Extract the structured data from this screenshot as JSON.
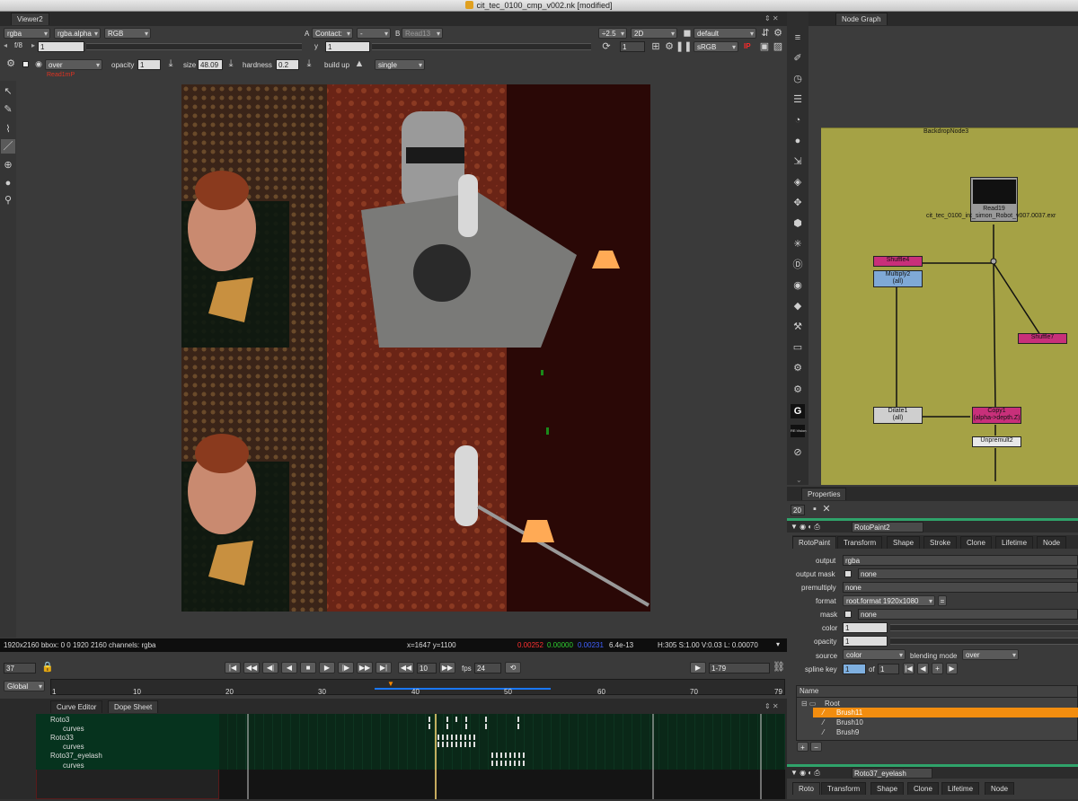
{
  "window": {
    "title": "cit_tec_0100_cmp_v002.nk [modified]"
  },
  "viewer": {
    "tab": "Viewer2",
    "channels": "rgba",
    "alpha": "rgba.alpha",
    "colorspace": "RGB",
    "a_label": "A",
    "a_input": "Contact:",
    "wipe": "-",
    "b_label": "B",
    "b_input": "Read13",
    "gain_mode": "f/8",
    "gain_value": "1",
    "gamma_label": "y",
    "gamma_value": "1",
    "zoom": "÷2.5",
    "view_mode": "2D",
    "lut": "default",
    "frame_field": "1",
    "display": "sRGB",
    "ip_label": "IP",
    "blend": "over",
    "opacity_label": "opacity",
    "opacity_value": "1",
    "size_label": "size",
    "size_value": "48.09",
    "hardness_label": "hardness",
    "hardness_value": "0.2",
    "buildup_label": "build up",
    "stroke_mode": "single",
    "red_label": "Read1mP",
    "status_left": "1920x2160 bbox: 0 0 1920 2160 channels: rgba",
    "status_xy": "x=1647 y=1100",
    "status_r": "0.00252",
    "status_g": "0.00000",
    "status_b": "0.00231",
    "status_a": "6.4e-13",
    "status_hsv": "H:305 S:1.00 V:0.03  L: 0.00070"
  },
  "timeline": {
    "frame": "37",
    "step": "10",
    "fps_label": "fps",
    "fps": "24",
    "range": "1-79",
    "global": "Global",
    "ticks": [
      "1",
      "10",
      "20",
      "30",
      "40",
      "50",
      "60",
      "70",
      "79"
    ],
    "current_marker": "37"
  },
  "dope": {
    "tab_curve": "Curve Editor",
    "tab_dope": "Dope Sheet",
    "items": [
      "Roto3",
      "curves",
      "Roto33",
      "curves",
      "Roto37_eyelash",
      "curves"
    ]
  },
  "nodegraph": {
    "tab": "Node Graph",
    "backdrop": "BackdropNode3",
    "read_name": "Read19",
    "read_file": "cit_tec_0100_int_simon_Robot_v007.0037.exr",
    "shuffle4": "Shuffle4",
    "multiply": "Multiply2",
    "multiply_sub": "(all)",
    "shuffle7": "Shuffle7",
    "dilate": "Dilate1",
    "dilate_sub": "(all)",
    "copy": "Copy1",
    "copy_sub": "(alpha->depth.Z)",
    "unpremult": "Unpremult2",
    "g_label": "G",
    "re_label": "RE:Vision"
  },
  "properties": {
    "tab": "Properties",
    "count": "20",
    "node_name": "RotoPaint2",
    "tabs": [
      "RotoPaint",
      "Transform",
      "Shape",
      "Stroke",
      "Clone",
      "Lifetime",
      "Node"
    ],
    "output_label": "output",
    "output_value": "rgba",
    "mask_label": "output mask",
    "mask_value": "none",
    "premult_label": "premultiply",
    "premult_value": "none",
    "format_label": "format",
    "format_value": "root.format 1920x1080",
    "mask2_label": "mask",
    "mask2_value": "none",
    "color_label": "color",
    "color_value": "1",
    "opacity_label": "opacity",
    "opacity_value": "1",
    "source_label": "source",
    "source_value": "color",
    "blendmode_label": "blending mode",
    "blendmode_value": "over",
    "splinekey_label": "spline key",
    "splinekey_value": "1",
    "of_label": "of",
    "of_value": "1",
    "tree_header": "Name",
    "tree": [
      "Root",
      "Brush11",
      "Brush10",
      "Brush9"
    ],
    "node2_name": "Roto37_eyelash",
    "tabs2": [
      "Roto",
      "Transform",
      "Shape",
      "Clone",
      "Lifetime",
      "Node"
    ]
  }
}
